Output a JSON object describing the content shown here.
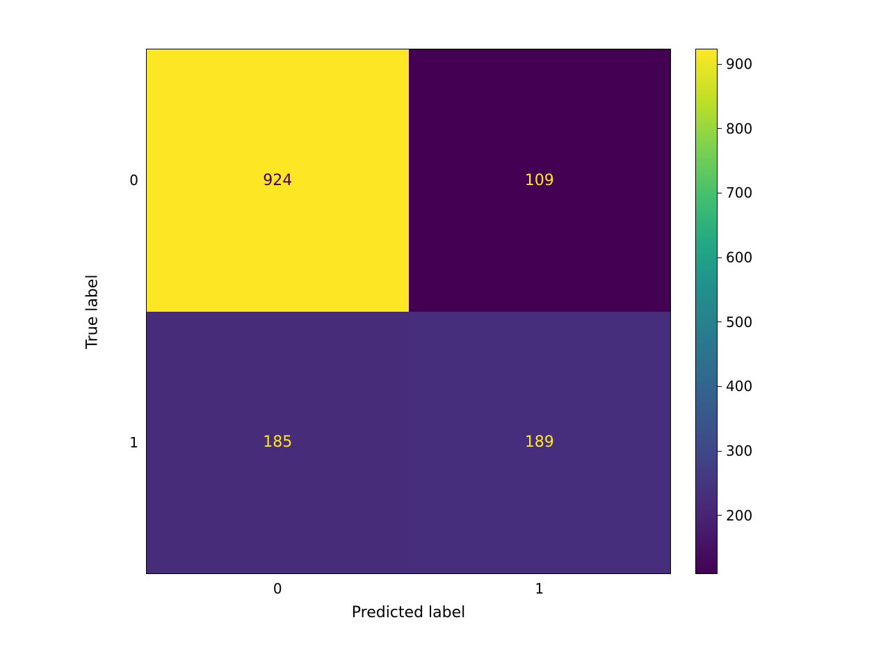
{
  "chart_data": {
    "type": "heatmap",
    "xlabel": "Predicted label",
    "ylabel": "True label",
    "x_categories": [
      "0",
      "1"
    ],
    "y_categories": [
      "0",
      "1"
    ],
    "matrix": [
      [
        924,
        109
      ],
      [
        185,
        189
      ]
    ],
    "vmin": 109,
    "vmax": 924,
    "colorbar_ticks": [
      200,
      300,
      400,
      500,
      600,
      700,
      800,
      900
    ],
    "colormap": "viridis"
  },
  "cells": [
    {
      "bg": "#fde725",
      "fg": "#440154",
      "label": "924"
    },
    {
      "bg": "#440154",
      "fg": "#fde725",
      "label": "109"
    },
    {
      "bg": "#472c7a",
      "fg": "#fde725",
      "label": "185"
    },
    {
      "bg": "#472e7c",
      "fg": "#fde725",
      "label": "189"
    }
  ],
  "cbar_tick_labels": [
    "200",
    "300",
    "400",
    "500",
    "600",
    "700",
    "800",
    "900"
  ]
}
